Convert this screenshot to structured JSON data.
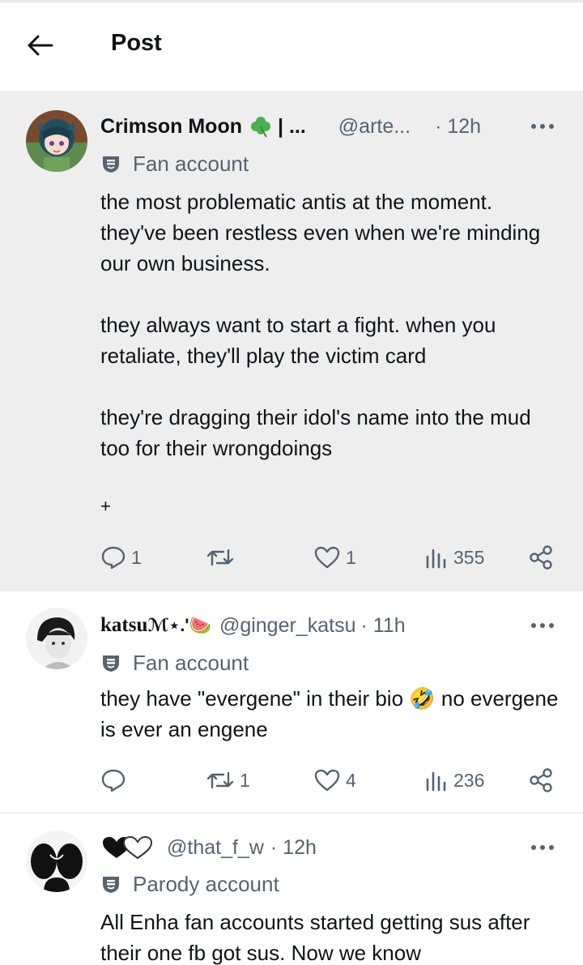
{
  "header": {
    "title": "Post"
  },
  "posts": [
    {
      "name": "Crimson Moon",
      "name_suffix": "| ...",
      "handle": "@arte...",
      "time": "· 12h",
      "badge": "Fan account",
      "body": "the most problematic antis at the moment. they've been restless even when we're minding our own business.\n\nthey always want to start a fight. when you retaliate, they'll play the victim card\n\nthey're dragging their idol's name into the mud too for their wrongdoings",
      "extra": "+",
      "replies": "1",
      "reposts": "",
      "likes": "1",
      "views": "355"
    },
    {
      "name": "katsu",
      "name_suffix": "ℳ⋆.'🍉",
      "handle": "@ginger_katsu",
      "time": "· 11h",
      "badge": "Fan account",
      "body_before": "they have \"evergene\" in their bio ",
      "emoji": "🤣",
      "body_after": " no evergene is ever an engene",
      "replies": "",
      "reposts": "1",
      "likes": "4",
      "views": "236"
    },
    {
      "name": "",
      "handle": "@that_f_w",
      "time": "· 12h",
      "badge": "Parody account",
      "body": "All Enha fan accounts started getting sus after their one fb got sus. Now we know"
    }
  ],
  "icons": {
    "back": "arrow-left-icon",
    "more": "more-horizontal-icon",
    "badge": "mask-badge-icon",
    "reply": "reply-icon",
    "repost": "repost-icon",
    "like": "heart-icon",
    "views": "views-icon",
    "share": "share-icon",
    "clover": "clover-icon",
    "hearts": "black-white-hearts-icon"
  },
  "colors": {
    "text": "#0f1419",
    "muted": "#536471",
    "highlight_bg": "#eeeeee",
    "clover": "#4caf50"
  }
}
